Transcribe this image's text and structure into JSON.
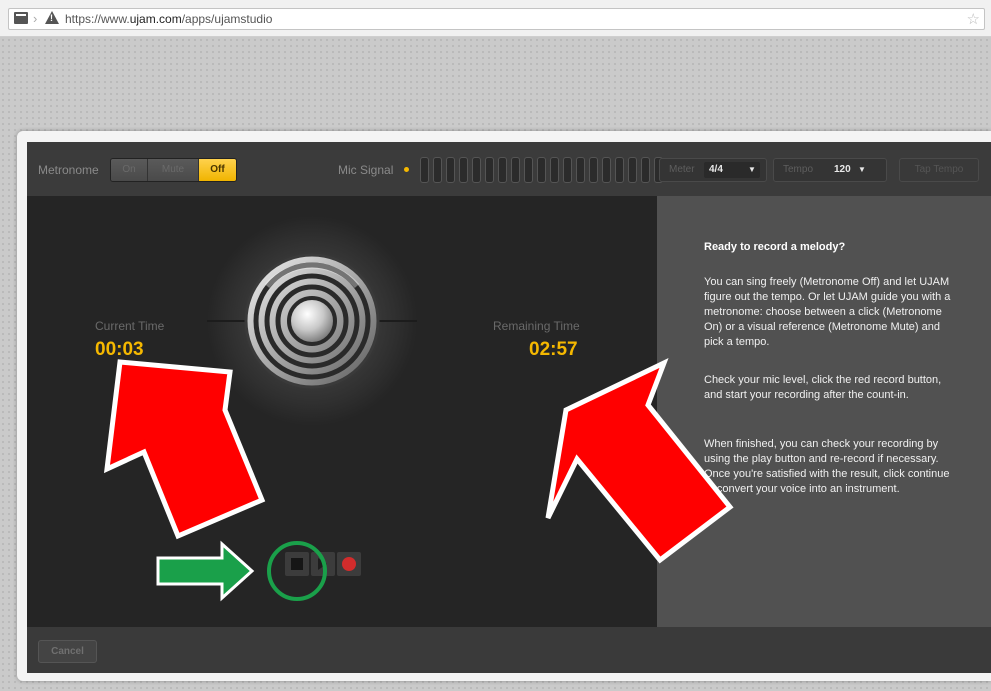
{
  "browser": {
    "url_prefix": "https://www.",
    "url_domain": "ujam.com",
    "url_path": "/apps/ujamstudio"
  },
  "toolbar": {
    "metronome_label": "Metronome",
    "metronome_options": [
      "On",
      "Mute",
      "Off"
    ],
    "metronome_selected": "Off",
    "mic_signal_label": "Mic Signal",
    "meter_label": "Meter",
    "meter_value": "4/4",
    "tempo_label": "Tempo",
    "tempo_value": "120",
    "tap_tempo_label": "Tap Tempo"
  },
  "recorder": {
    "current_time_label": "Current Time",
    "current_time": "00:03",
    "remaining_time_label": "Remaining Time",
    "remaining_time": "02:57"
  },
  "info": {
    "title": "Ready to record a melody?",
    "paragraph1": "You can sing freely (Metronome Off) and let UJAM figure out the tempo. Or let UJAM guide you with a metronome: choose between a click (Metronome On) or a visual reference (Metronome Mute) and pick a tempo.",
    "paragraph2": "Check your mic level, click the red record button, and start your recording after the count-in.",
    "paragraph3": "When finished, you can check your recording by using the play button and re-record if necessary. Once you're satisfied with the result, click continue or convert your voice into an instrument."
  },
  "footer": {
    "cancel_label": "Cancel"
  },
  "annotations": {
    "arrow_color": "#ff0000",
    "green_arrow_color": "#1aa04a",
    "circle_color": "#1aa04a"
  },
  "colors": {
    "accent": "#f5b800",
    "record": "#d22c2c"
  }
}
